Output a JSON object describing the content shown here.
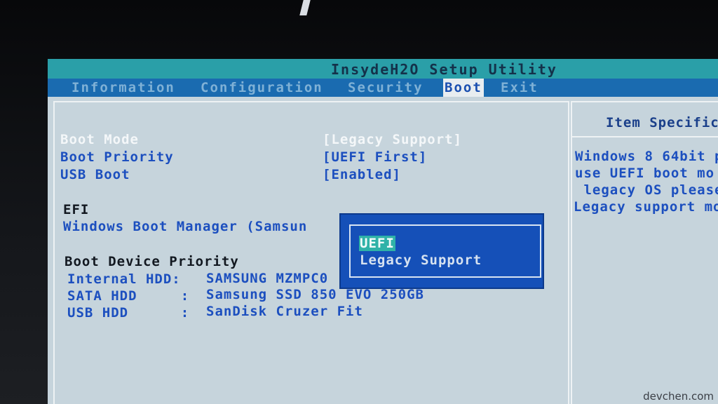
{
  "app": {
    "title": "InsydeH2O Setup Utility"
  },
  "menu": {
    "items": [
      {
        "label": "Information",
        "active": false
      },
      {
        "label": "Configuration",
        "active": false
      },
      {
        "label": "Security",
        "active": false
      },
      {
        "label": "Boot",
        "active": true
      },
      {
        "label": "Exit",
        "active": false
      }
    ]
  },
  "settings": {
    "boot_mode": {
      "label": "Boot Mode",
      "value": "[Legacy Support]"
    },
    "boot_priority": {
      "label": "Boot Priority",
      "value": "[UEFI First]"
    },
    "usb_boot": {
      "label": "USB Boot",
      "value": "[Enabled]"
    }
  },
  "efi": {
    "header": "EFI",
    "entry": "Windows Boot Manager (Samsun"
  },
  "boot_device_priority": {
    "header": "Boot Device Priority",
    "devices": [
      {
        "type": "Internal HDD:",
        "name": "SAMSUNG MZMPC0"
      },
      {
        "type": "SATA HDD     :",
        "name": "Samsung SSD 850 EVO 250GB"
      },
      {
        "type": "USB HDD      :",
        "name": "SanDisk Cruzer Fit"
      }
    ]
  },
  "popup": {
    "options": [
      {
        "label": "UEFI",
        "selected": true
      },
      {
        "label": "Legacy Support",
        "selected": false
      }
    ]
  },
  "help": {
    "title": "Item Specific",
    "lines": [
      "Windows 8 64bit p",
      "use UEFI boot mo",
      " legacy OS please",
      "Legacy support mo"
    ]
  },
  "watermark": "devchen.com",
  "colors": {
    "screen_bg": "#c6d4dc",
    "menu_bar": "#1a6bb0",
    "title_bar": "#2a9fa8",
    "popup_bg": "#1550b8",
    "selected_option": "#2fb2a8"
  }
}
